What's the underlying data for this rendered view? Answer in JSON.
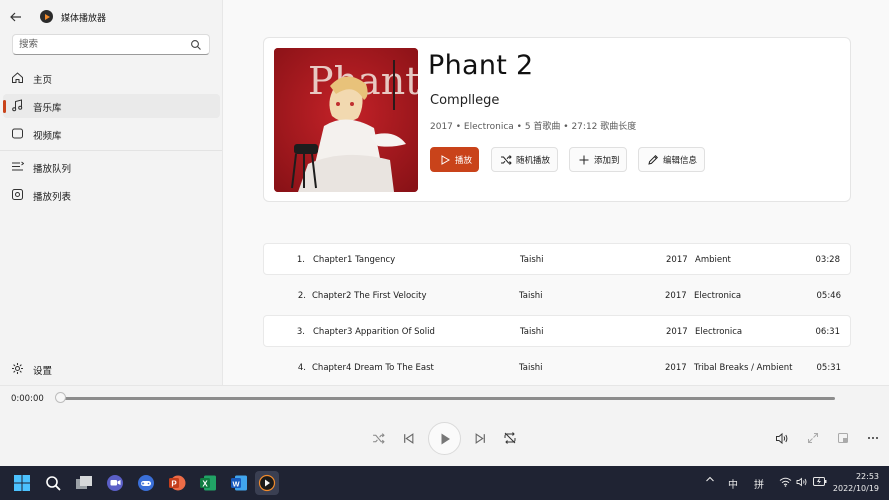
{
  "app": {
    "title": "媒体播放器",
    "window_controls": [
      "minimize",
      "maximize",
      "close"
    ]
  },
  "sidebar": {
    "search_placeholder": "搜索",
    "items": [
      {
        "label": "主页",
        "icon": "home-icon"
      },
      {
        "label": "音乐库",
        "icon": "music-note-icon",
        "active": true
      },
      {
        "label": "视频库",
        "icon": "video-icon"
      },
      {
        "label": "播放队列",
        "icon": "queue-icon"
      },
      {
        "label": "播放列表",
        "icon": "playlist-icon"
      }
    ],
    "settings_label": "设置"
  },
  "album": {
    "title": "Phant 2",
    "artist": "Compllege",
    "meta": "2017 • Electronica • 5 首歌曲 • 27:12 歌曲长度",
    "buttons": {
      "play": "播放",
      "shuffle": "随机播放",
      "add": "添加到",
      "edit": "编辑信息"
    },
    "accent_color": "#c9431a"
  },
  "tracks": [
    {
      "num": "1.",
      "title": "Chapter1 Tangency",
      "artist": "Taishi",
      "year": "2017",
      "genre": "Ambient",
      "duration": "03:28"
    },
    {
      "num": "2.",
      "title": "Chapter2 The First Velocity",
      "artist": "Taishi",
      "year": "2017",
      "genre": "Electronica",
      "duration": "05:46"
    },
    {
      "num": "3.",
      "title": "Chapter3 Apparition Of Solid",
      "artist": "Taishi",
      "year": "2017",
      "genre": "Electronica",
      "duration": "06:31"
    },
    {
      "num": "4.",
      "title": "Chapter4 Dream To The East",
      "artist": "Taishi",
      "year": "2017",
      "genre": "Tribal Breaks / Ambient",
      "duration": "05:31"
    }
  ],
  "player": {
    "current_time": "0:00:00",
    "progress": 0
  },
  "taskbar": {
    "ime_mode": "中",
    "ime_input": "拼",
    "time": "22:53",
    "date": "2022/10/19"
  }
}
